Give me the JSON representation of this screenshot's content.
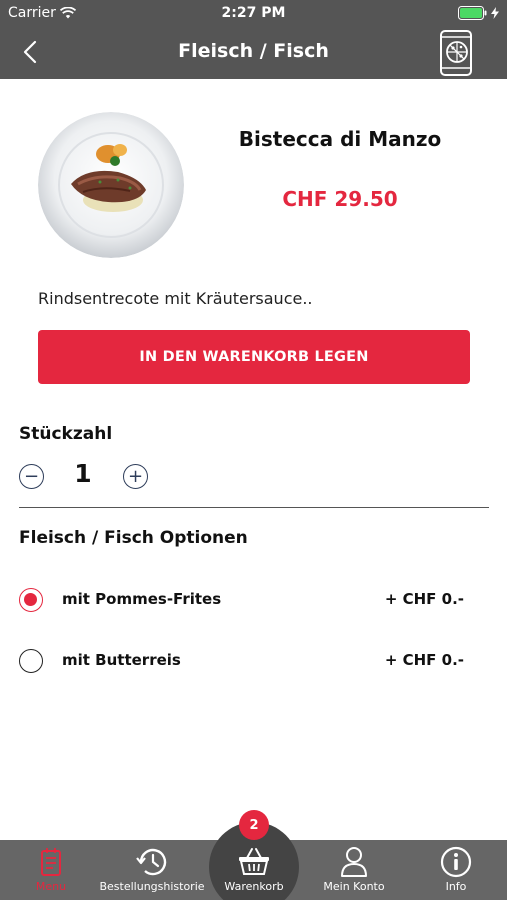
{
  "status_bar": {
    "carrier": "Carrier",
    "time": "2:27 PM"
  },
  "nav": {
    "title": "Fleisch / Fisch",
    "back_icon": "chevron-left-icon",
    "right_icon": "phone-pizza-icon"
  },
  "product": {
    "name": "Bistecca di Manzo",
    "price": "CHF 29.50",
    "description": "Rindsentrecote mit Kräutersauce..",
    "add_to_cart_label": "IN DEN WARENKORB LEGEN"
  },
  "quantity": {
    "label": "Stückzahl",
    "value": "1",
    "minus_symbol": "−",
    "plus_symbol": "+"
  },
  "options": {
    "title": "Fleisch / Fisch Optionen",
    "items": [
      {
        "label": "mit Pommes-Frites",
        "price": "+ CHF 0.-",
        "selected": true
      },
      {
        "label": "mit Butterreis",
        "price": "+ CHF 0.-",
        "selected": false
      }
    ]
  },
  "tabbar": {
    "items": [
      {
        "label": "Menu",
        "icon": "menu-book-icon",
        "active": true
      },
      {
        "label": "Bestellungshistorie",
        "icon": "history-icon",
        "active": false
      },
      {
        "label": "Warenkorb",
        "icon": "basket-icon",
        "active": false
      },
      {
        "label": "Mein Konto",
        "icon": "user-icon",
        "active": false
      },
      {
        "label": "Info",
        "icon": "info-icon",
        "active": false
      }
    ],
    "cart_badge": "2"
  },
  "colors": {
    "accent": "#e4273f",
    "bar": "#555555",
    "tabbar": "#666666"
  }
}
